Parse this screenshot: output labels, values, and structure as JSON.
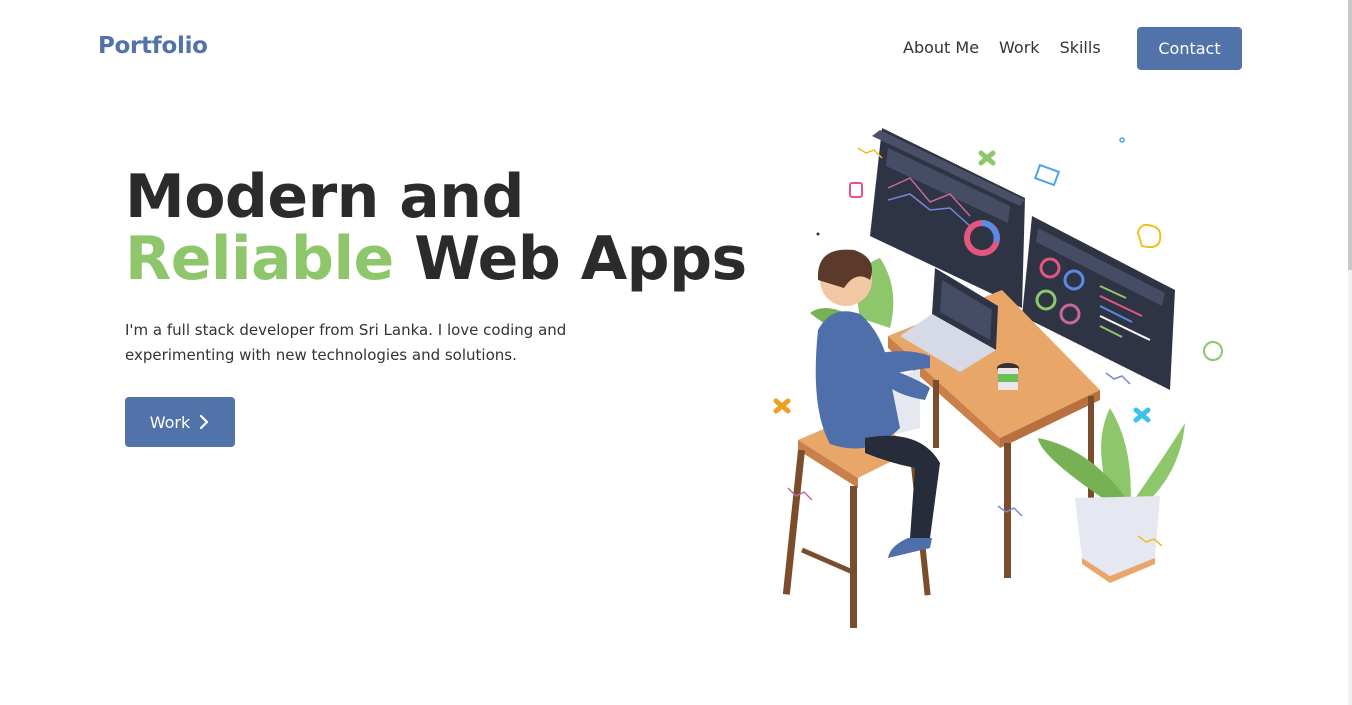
{
  "header": {
    "logo": "Portfolio",
    "nav": [
      "About Me",
      "Work",
      "Skills"
    ],
    "contact_label": "Contact"
  },
  "hero": {
    "line1": "Modern and",
    "accent": "Reliable",
    "line2_rest": " Web Apps",
    "intro": "I'm a full stack developer from Sri Lanka. I love coding and experimenting with new technologies and solutions.",
    "work_label": "Work",
    "work_icon": "chevron-right-icon"
  },
  "colors": {
    "brand": "#5173aa",
    "accent": "#8dc66b",
    "text": "#2b2b2b"
  }
}
